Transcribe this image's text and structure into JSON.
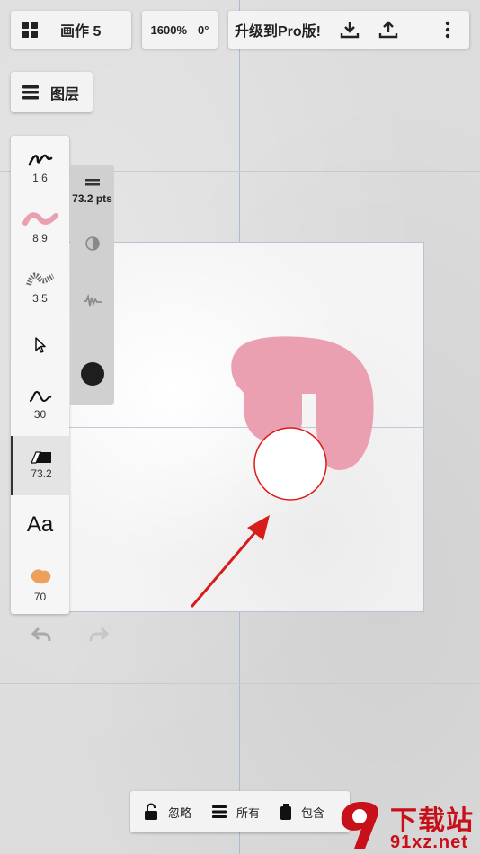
{
  "document": {
    "title": "画作 5"
  },
  "view": {
    "zoom": "1600%",
    "rotation": "0°"
  },
  "header": {
    "upgrade_label": "升级到Pro版!"
  },
  "layers": {
    "label": "图层"
  },
  "tools": [
    {
      "name": "pencil",
      "value": "1.6"
    },
    {
      "name": "airbrush",
      "value": "8.9"
    },
    {
      "name": "texture",
      "value": "3.5"
    },
    {
      "name": "select",
      "value": ""
    },
    {
      "name": "curve",
      "value": "30"
    },
    {
      "name": "eraser",
      "value": "73.2"
    },
    {
      "name": "text",
      "label": "Aa"
    },
    {
      "name": "smudge",
      "value": "70"
    }
  ],
  "brush_panel": {
    "size_label": "73.2 pts"
  },
  "colors": {
    "stroke": "#eba0b2",
    "current": "#1e1e1e",
    "cursor": "#e01818",
    "arrow": "#d81c1c"
  },
  "bottom_bar": {
    "lock_label": "忽略",
    "layers_label": "所有",
    "contain_label": "包含"
  },
  "watermark": {
    "brand": "下载站",
    "site": "91xz.net"
  }
}
